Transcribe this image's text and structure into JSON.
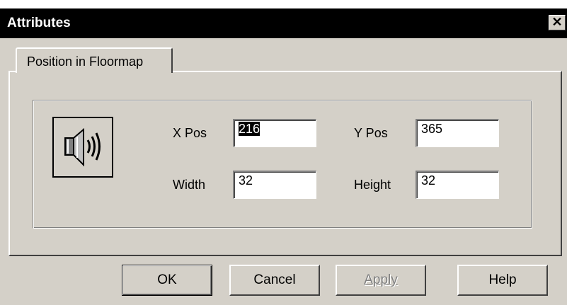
{
  "window": {
    "title": "Attributes",
    "close_glyph": "✕"
  },
  "tabs": [
    {
      "label": "Position in Floormap",
      "active": true
    }
  ],
  "icon": {
    "name": "speaker-icon"
  },
  "fields": {
    "x_pos": {
      "label": "X Pos",
      "value": "216",
      "selected": true
    },
    "y_pos": {
      "label": "Y Pos",
      "value": "365"
    },
    "width": {
      "label": "Width",
      "value": "32"
    },
    "height": {
      "label": "Height",
      "value": "32"
    }
  },
  "buttons": {
    "ok": "OK",
    "cancel": "Cancel",
    "apply": "Apply",
    "apply_enabled": false,
    "help": "Help"
  },
  "colors": {
    "face": "#d4d0c8",
    "titlebar": "#000000",
    "title_text": "#ffffff"
  }
}
